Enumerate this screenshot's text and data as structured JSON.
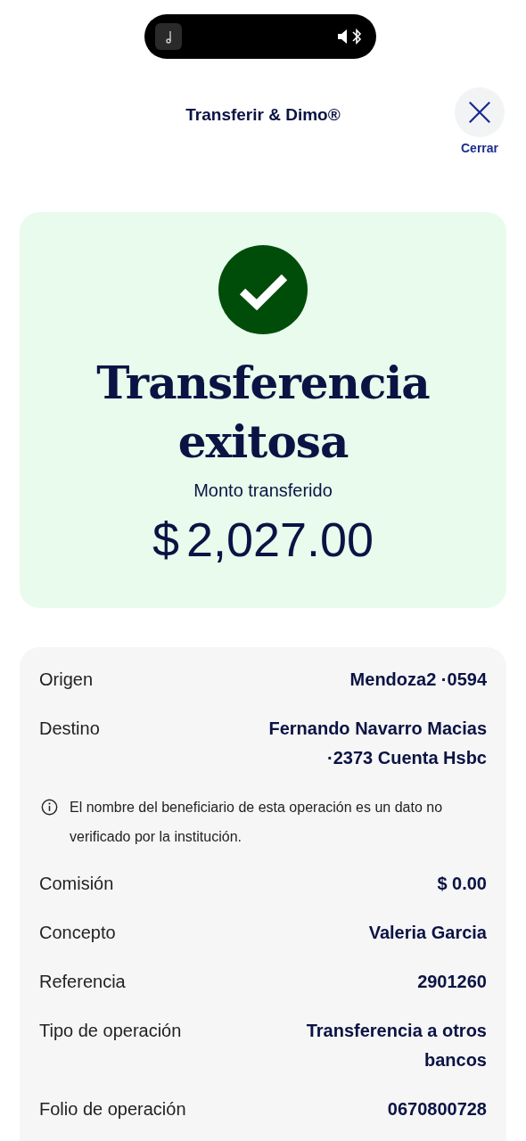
{
  "header": {
    "title": "Transferir & Dimo®",
    "close_label": "Cerrar"
  },
  "result": {
    "succeeded": true,
    "title": "Transferencia exitosa",
    "amount_label": "Monto transferido",
    "currency": "$",
    "amount": "2,027.00"
  },
  "details": [
    {
      "kind": "row",
      "label": "Origen",
      "value": "Mendoza2 ·0594"
    },
    {
      "kind": "row",
      "label": "Destino",
      "value": "Fernando Navarro Macias ·2373 Cuenta Hsbc"
    },
    {
      "kind": "note",
      "text": "El nombre del beneficiario de esta operación es un dato no verificado por la institución."
    },
    {
      "kind": "row",
      "label": "Comisión",
      "value": "$ 0.00"
    },
    {
      "kind": "row",
      "label": "Concepto",
      "value": "Valeria Garcia"
    },
    {
      "kind": "row",
      "label": "Referencia",
      "value": "2901260"
    },
    {
      "kind": "row",
      "label": "Tipo de operación",
      "value": "Transferencia a otros bancos"
    },
    {
      "kind": "row",
      "label": "Folio de operación",
      "value": "0670800728"
    }
  ]
}
